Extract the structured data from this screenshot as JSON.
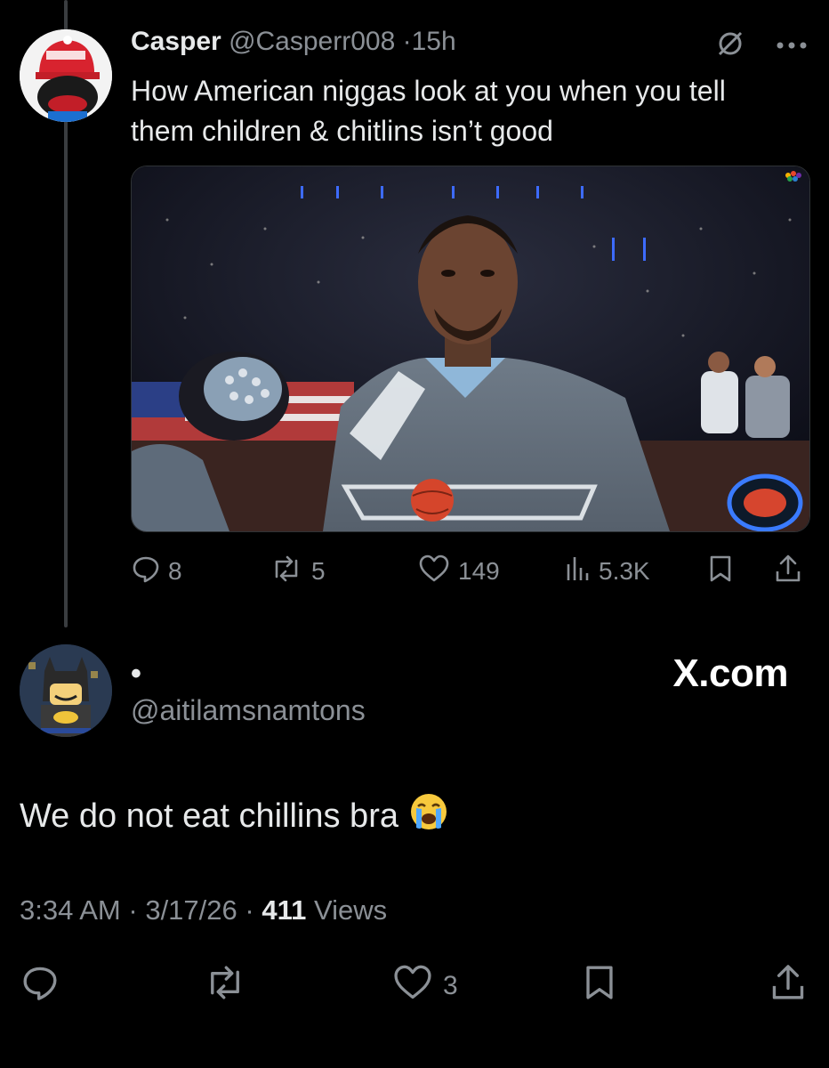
{
  "tweet": {
    "author_name": "Casper",
    "author_handle": "@Casperr008",
    "separator": "·",
    "time_ago": "15h",
    "text": "How American niggas look at you when you tell them children & chitlins isn’t good",
    "stats": {
      "replies": "8",
      "reposts": "5",
      "likes": "149",
      "views": "5.3K"
    }
  },
  "reply": {
    "author_name": "•",
    "author_handle": "@aitilamsnamtons",
    "watermark": "X.com",
    "text": "We do not eat chillins bra",
    "emoji": "😭",
    "time": "3:34 AM",
    "sep1": "·",
    "date": "3/17/26",
    "sep2": "·",
    "views_count": "411",
    "views_label": "Views",
    "stats": {
      "likes": "3"
    }
  },
  "icons": {
    "muted": "muted-icon",
    "more": "more-icon",
    "reply": "reply-icon",
    "repost": "repost-icon",
    "like": "heart-icon",
    "views": "views-icon",
    "bookmark": "bookmark-icon",
    "share": "share-icon"
  },
  "colors": {
    "background": "#000000",
    "text": "#e7e9ea",
    "muted_text": "#8b9096",
    "thread_line": "#3a3d40"
  }
}
